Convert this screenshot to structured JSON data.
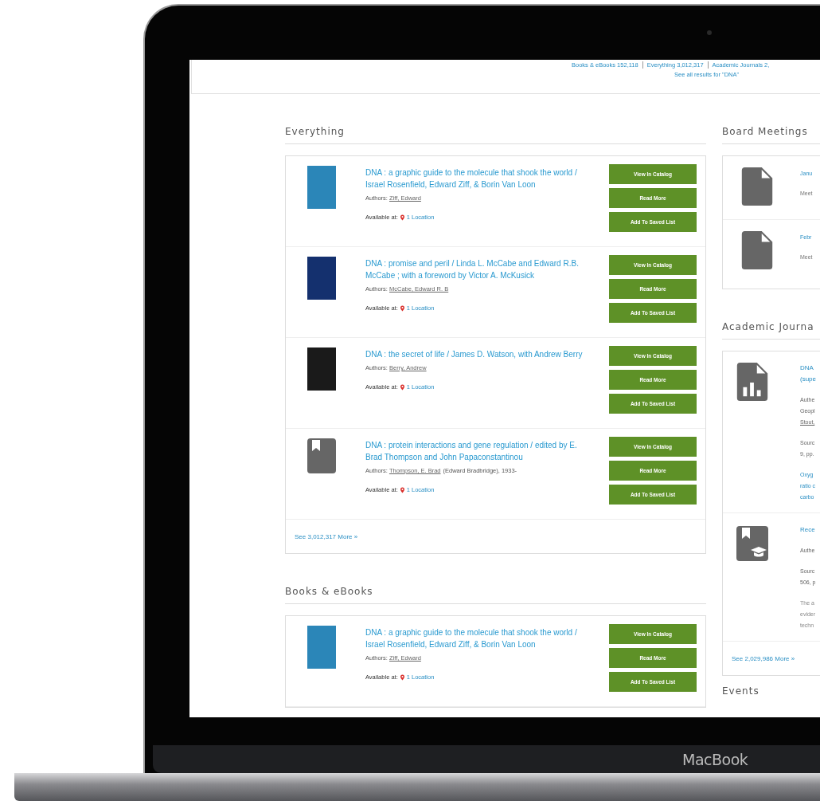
{
  "device": {
    "brand": "MacBook"
  },
  "summary": {
    "links": [
      {
        "label": "Books & eBooks 152,118"
      },
      {
        "label": "Everything 3,012,317"
      },
      {
        "label": "Academic Journals 2,"
      }
    ],
    "see_all": "See all results for \"DNA\""
  },
  "results": [
    {
      "title": "Everything",
      "items": [
        {
          "kind": "cover",
          "color": "#2b86b8",
          "title": "DNA : a graphic guide to the molecule that shook the world / Israel Rosenfield, Edward Ziff, & Borin Van Loon",
          "authors_label": "Authors:",
          "author": "Ziff, Edward",
          "available_label": "Available at:",
          "location": "1 Location",
          "buttons": [
            "View In Catalog",
            "Read More",
            "Add To Saved List"
          ]
        },
        {
          "kind": "cover",
          "color": "#14306e",
          "title": "DNA : promise and peril / Linda L. McCabe and Edward R.B. McCabe ; with a foreword by Victor A. McKusick",
          "authors_label": "Authors:",
          "author": "McCabe, Edward R. B",
          "available_label": "Available at:",
          "location": "1 Location",
          "buttons": [
            "View In Catalog",
            "Read More",
            "Add To Saved List"
          ]
        },
        {
          "kind": "cover",
          "color": "#1a1a1a",
          "title": "DNA : the secret of life / James D. Watson, with Andrew Berry",
          "authors_label": "Authors:",
          "author": "Berry, Andrew",
          "available_label": "Available at:",
          "location": "1 Location",
          "buttons": [
            "View In Catalog",
            "Read More",
            "Add To Saved List"
          ]
        },
        {
          "kind": "bookmark",
          "title": "DNA : protein interactions and gene regulation / edited by E. Brad Thompson and John Papaconstantinou",
          "authors_label": "Authors:",
          "author": "Thompson, E. Brad",
          "author_note": "(Edward Bradbridge), 1933-",
          "available_label": "Available at:",
          "location": "1 Location",
          "buttons": [
            "View In Catalog",
            "Read More",
            "Add To Saved List"
          ]
        }
      ],
      "more": "See 3,012,317 More »"
    },
    {
      "title": "Books & eBooks",
      "items": [
        {
          "kind": "cover",
          "color": "#2b86b8",
          "title": "DNA : a graphic guide to the molecule that shook the world / Israel Rosenfield, Edward Ziff, & Borin Van Loon",
          "authors_label": "Authors:",
          "author": "Ziff, Edward",
          "available_label": "Available at:",
          "location": "1 Location",
          "buttons": [
            "View In Catalog",
            "Read More",
            "Add To Saved List"
          ]
        }
      ]
    }
  ],
  "board_meetings": {
    "title": "Board Meetings",
    "items": [
      {
        "title": "Janu",
        "text": "Meet"
      },
      {
        "title": "Febr",
        "text": "Meet"
      }
    ]
  },
  "journals": {
    "title": "Academic Journa",
    "items": [
      {
        "kind": "chart",
        "blocks": [
          {
            "kind": "title",
            "lines": [
              "DNA",
              "(supe"
            ]
          },
          {
            "kind": "authors",
            "lines": [
              "Authe",
              "Geopl"
            ]
          },
          {
            "kind": "author-link",
            "lines": [
              "Stout,"
            ]
          },
          {
            "kind": "source",
            "lines": [
              "Sourc",
              "9, pp."
            ]
          },
          {
            "kind": "abstract",
            "lines": [
              "Oxyg",
              "ratio c",
              "carbo"
            ]
          }
        ]
      },
      {
        "kind": "cap",
        "blocks": [
          {
            "kind": "title",
            "lines": [
              "Rece"
            ]
          },
          {
            "kind": "authors",
            "lines": [
              "Authe"
            ]
          },
          {
            "kind": "source",
            "lines": [
              "Sourc",
              "506, p"
            ]
          },
          {
            "kind": "summary",
            "lines": [
              "The a",
              "evider",
              "techn"
            ]
          }
        ]
      }
    ],
    "more": "See 2,029,986 More »"
  },
  "events": {
    "title": "Events"
  }
}
